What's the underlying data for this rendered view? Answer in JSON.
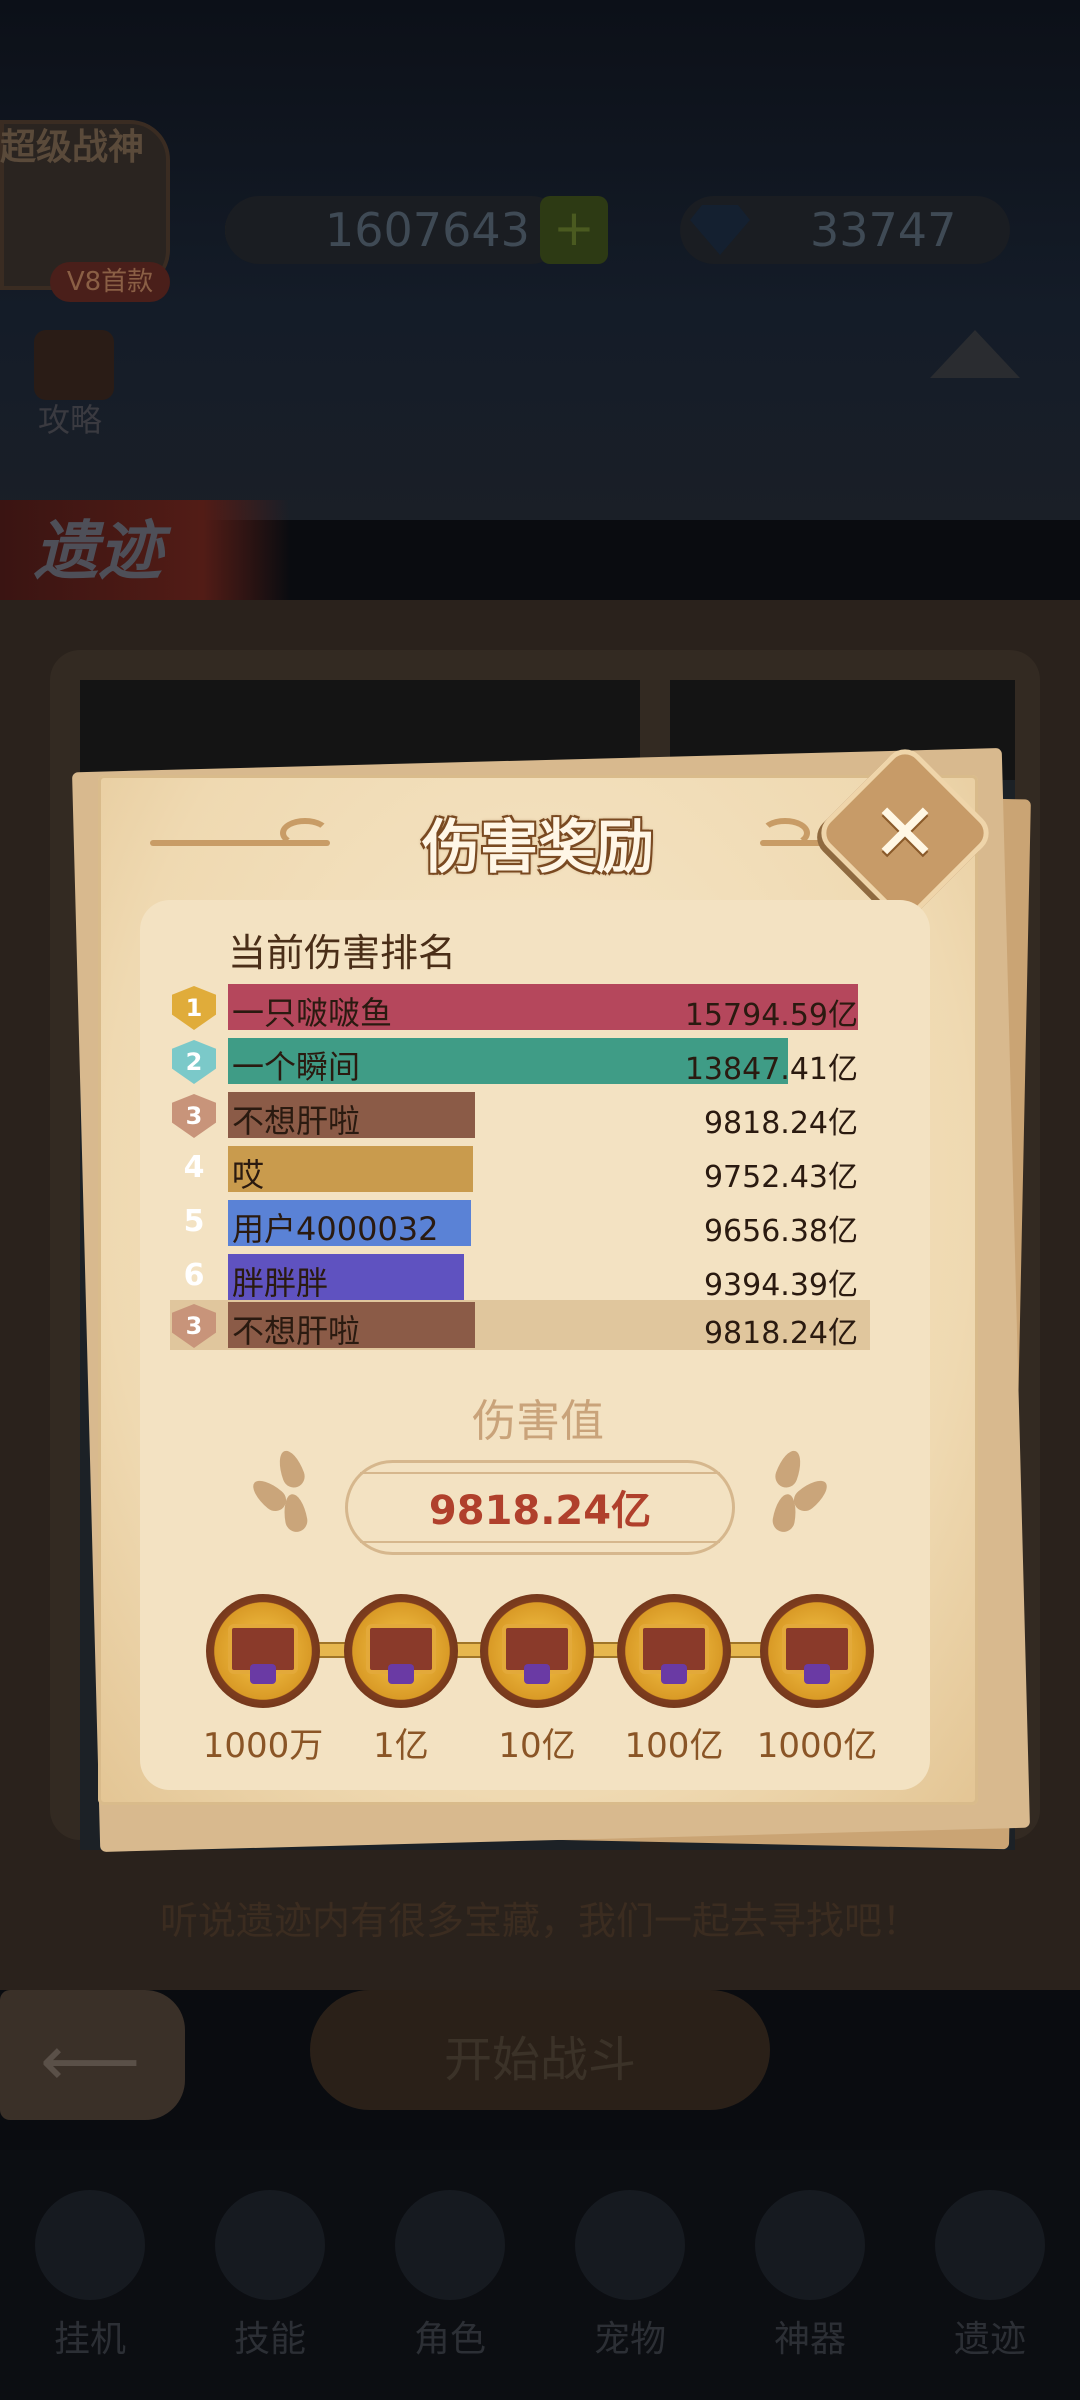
{
  "background": {
    "player_name": "超级战神",
    "vip_label": "V8首款",
    "coins": "1607643",
    "gems": "33747",
    "strategy_label": "攻略",
    "scene_title": "遗迹",
    "hint": "听说遗迹内有很多宝藏，我们一起去寻找吧！",
    "start_label": "开始战斗",
    "nav": [
      "挂机",
      "技能",
      "角色",
      "宠物",
      "神器",
      "遗迹"
    ]
  },
  "modal": {
    "title": "伤害奖励",
    "close_label": "✕",
    "ranking_heading": "当前伤害排名",
    "rankings": [
      {
        "rank": "1",
        "name": "一只啵啵鱼",
        "value": "15794.59亿",
        "bar_color": "#b5475c",
        "badge_color": "#e0ac3a"
      },
      {
        "rank": "2",
        "name": "一个瞬间",
        "value": "13847.41亿",
        "bar_color": "#3f9c86",
        "badge_color": "#7bc9c9"
      },
      {
        "rank": "3",
        "name": "不想肝啦",
        "value": "9818.24亿",
        "bar_color": "#8b5b47",
        "badge_color": "#c8947a"
      },
      {
        "rank": "4",
        "name": "哎",
        "value": "9752.43亿",
        "bar_color": "#c99b4d",
        "badge_color": ""
      },
      {
        "rank": "5",
        "name": "用户4000032",
        "value": "9656.38亿",
        "bar_color": "#5a82d6",
        "badge_color": ""
      },
      {
        "rank": "6",
        "name": "胖胖胖",
        "value": "9394.39亿",
        "bar_color": "#5f52c0",
        "badge_color": ""
      }
    ],
    "self_rank": {
      "rank": "3",
      "name": "不想肝啦",
      "value": "9818.24亿",
      "bar_color": "#8b5b47",
      "badge_color": "#c8947a"
    },
    "damage_heading": "伤害值",
    "damage_value": "9818.24亿",
    "chests": [
      "1000万",
      "1亿",
      "10亿",
      "100亿",
      "1000亿"
    ]
  }
}
